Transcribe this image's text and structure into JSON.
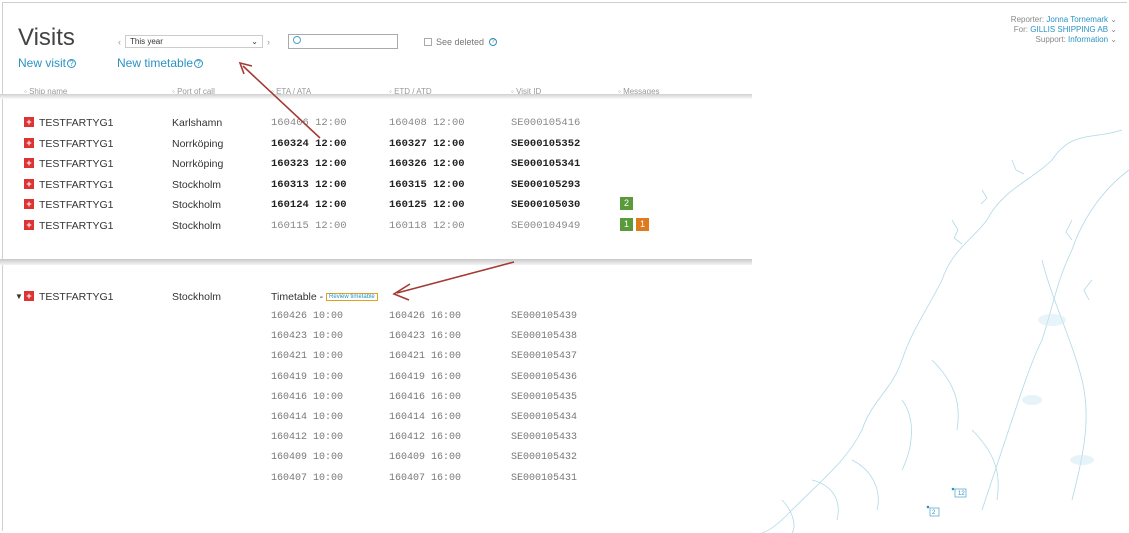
{
  "header": {
    "title": "Visits",
    "period": "This year",
    "see_deleted": "See deleted",
    "new_visit": "New visit",
    "new_timetable": "New timetable"
  },
  "account": {
    "reporter_label": "Reporter:",
    "reporter": "Jonna Tornemark",
    "for_label": "For:",
    "for": "GILLIS SHIPPING AB",
    "support_label": "Support:",
    "support": "Information"
  },
  "columns": {
    "ship": "Ship name",
    "port": "Port of call",
    "eta": "ETA / ATA",
    "etd": "ETD / ATD",
    "vid": "Visit ID",
    "msg": "Messages"
  },
  "visits": [
    {
      "ship": "TESTFARTYG1",
      "port": "Karlshamn",
      "eta": "160406 12:00",
      "etd": "160408 12:00",
      "vid": "SE000105416",
      "bold": false,
      "msgs": []
    },
    {
      "ship": "TESTFARTYG1",
      "port": "Norrköping",
      "eta": "160324 12:00",
      "etd": "160327 12:00",
      "vid": "SE000105352",
      "bold": true,
      "msgs": []
    },
    {
      "ship": "TESTFARTYG1",
      "port": "Norrköping",
      "eta": "160323 12:00",
      "etd": "160326 12:00",
      "vid": "SE000105341",
      "bold": true,
      "msgs": []
    },
    {
      "ship": "TESTFARTYG1",
      "port": "Stockholm",
      "eta": "160313 12:00",
      "etd": "160315 12:00",
      "vid": "SE000105293",
      "bold": true,
      "msgs": []
    },
    {
      "ship": "TESTFARTYG1",
      "port": "Stockholm",
      "eta": "160124 12:00",
      "etd": "160125 12:00",
      "vid": "SE000105030",
      "bold": true,
      "msgs": [
        {
          "n": "2",
          "c": "g"
        }
      ]
    },
    {
      "ship": "TESTFARTYG1",
      "port": "Stockholm",
      "eta": "160115 12:00",
      "etd": "160118 12:00",
      "vid": "SE000104949",
      "bold": false,
      "msgs": [
        {
          "n": "1",
          "c": "g"
        },
        {
          "n": "1",
          "c": "o"
        }
      ]
    }
  ],
  "timetable": {
    "ship": "TESTFARTYG1",
    "port": "Stockholm",
    "label": "Timetable - ",
    "review": "Review timetable",
    "rows": [
      {
        "eta": "160426 10:00",
        "etd": "160426 16:00",
        "vid": "SE000105439"
      },
      {
        "eta": "160423 10:00",
        "etd": "160423 16:00",
        "vid": "SE000105438"
      },
      {
        "eta": "160421 10:00",
        "etd": "160421 16:00",
        "vid": "SE000105437"
      },
      {
        "eta": "160419 10:00",
        "etd": "160419 16:00",
        "vid": "SE000105436"
      },
      {
        "eta": "160416 10:00",
        "etd": "160416 16:00",
        "vid": "SE000105435"
      },
      {
        "eta": "160414 10:00",
        "etd": "160414 16:00",
        "vid": "SE000105434"
      },
      {
        "eta": "160412 10:00",
        "etd": "160412 16:00",
        "vid": "SE000105433"
      },
      {
        "eta": "160409 10:00",
        "etd": "160409 16:00",
        "vid": "SE000105432"
      },
      {
        "eta": "160407 10:00",
        "etd": "160407 16:00",
        "vid": "SE000105431"
      }
    ]
  },
  "map_markers": [
    "12",
    "2"
  ],
  "colors": {
    "accent": "#2a93c4",
    "flag": "#dd3333",
    "msg_green": "#5a9a3a",
    "msg_orange": "#e07a1f",
    "annotation_arrow": "#a33a33"
  }
}
